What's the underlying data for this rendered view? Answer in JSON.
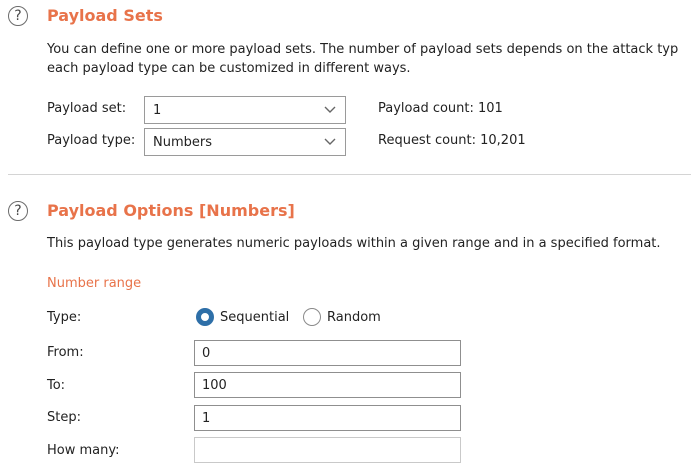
{
  "payload_sets": {
    "title": "Payload Sets",
    "description_line1": "You can define one or more payload sets. The number of payload sets depends on the attack typ",
    "description_line2": "each payload type can be customized in different ways.",
    "payload_set_label": "Payload set:",
    "payload_set_value": "1",
    "payload_type_label": "Payload type:",
    "payload_type_value": "Numbers",
    "payload_count": "Payload count: 101",
    "request_count": "Request count: 10,201"
  },
  "payload_options": {
    "title": "Payload Options [Numbers]",
    "description": "This payload type generates numeric payloads within a given range and in a specified format.",
    "number_range_heading": "Number range",
    "type_label": "Type:",
    "type_options": [
      "Sequential",
      "Random"
    ],
    "type_selected": "Sequential",
    "from_label": "From:",
    "from_value": "0",
    "to_label": "To:",
    "to_value": "100",
    "step_label": "Step:",
    "step_value": "1",
    "how_many_label": "How many:",
    "how_many_value": ""
  },
  "colors": {
    "accent": "#e8734a",
    "radio_selected": "#2e6fa8"
  },
  "icons": [
    "help-icon",
    "chevron-down-icon"
  ]
}
